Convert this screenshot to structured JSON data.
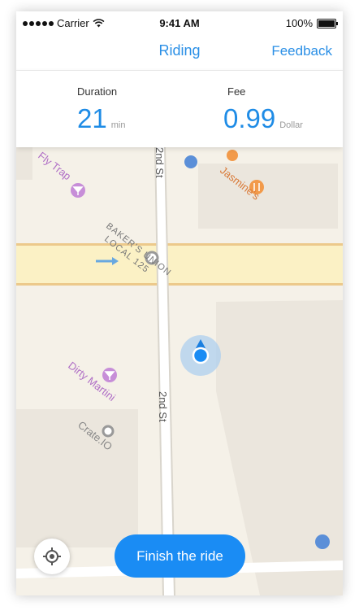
{
  "status": {
    "carrier": "Carrier",
    "time": "9:41 AM",
    "battery": "100%"
  },
  "nav": {
    "title": "Riding",
    "feedback_label": "Feedback"
  },
  "ride": {
    "duration_label": "Duration",
    "duration_value": "21",
    "duration_unit": "min",
    "fee_label": "Fee",
    "fee_value": "0.99",
    "fee_unit": "Dollar"
  },
  "map": {
    "labels": {
      "fly_trap": "Fly Trap",
      "second_st_top": "2nd St",
      "jasmines": "Jasmine's",
      "bakers_union_1": "BAKER'S UNION",
      "bakers_union_2": "LOCAL 125",
      "dirty_martini": "Dirty Martini",
      "second_st_bottom": "2nd St",
      "crate_io": "Crate.IO"
    }
  },
  "actions": {
    "finish_label": "Finish the ride"
  },
  "colors": {
    "accent": "#1a8cf4",
    "link": "#2a8fe6"
  }
}
